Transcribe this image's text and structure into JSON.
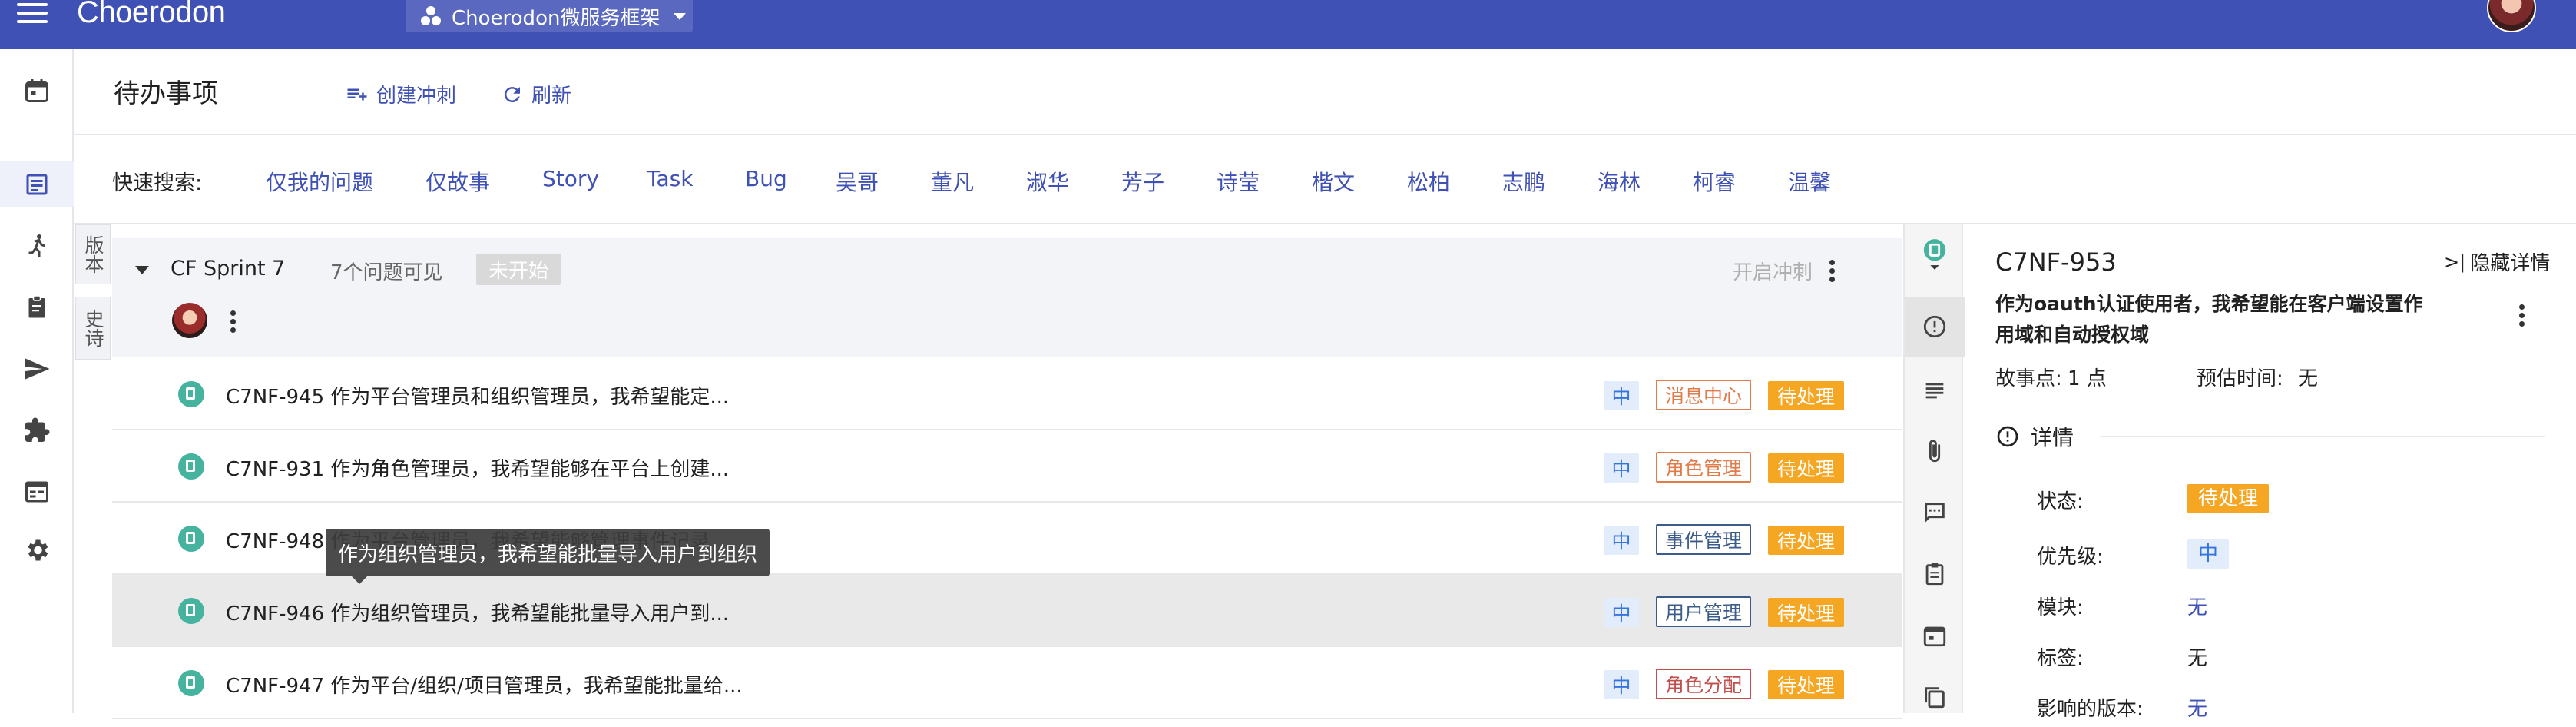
{
  "app": {
    "brand": "Choerodon",
    "project": "Choerodon微服务框架"
  },
  "page": {
    "title": "待办事项",
    "create_sprint": "创建冲刺",
    "refresh": "刷新"
  },
  "quick_search": {
    "label": "快速搜索:",
    "items": [
      "仅我的问题",
      "仅故事",
      "Story",
      "Task",
      "Bug",
      "吴哥",
      "董凡",
      "淑华",
      "芳子",
      "诗莹",
      "楷文",
      "松柏",
      "志鹏",
      "海林",
      "柯睿",
      "温馨"
    ]
  },
  "vertical_tabs": {
    "version": "版本",
    "epic": "史诗"
  },
  "sprint": {
    "name": "CF Sprint 7",
    "count": "7个问题可见",
    "status": "未开始",
    "start": "开启冲刺"
  },
  "issues": [
    {
      "text": "C7NF-945 作为平台管理员和组织管理员，我希望能定...",
      "priority": "中",
      "component": "消息中心",
      "component_color": "#e07b4a",
      "status": "待处理"
    },
    {
      "text": "C7NF-931 作为角色管理员，我希望能够在平台上创建...",
      "priority": "中",
      "component": "角色管理",
      "component_color": "#e07b4a",
      "status": "待处理"
    },
    {
      "text": "C7NF-948 作为平台管理员，我希望能够管理事件记录",
      "priority": "中",
      "component": "事件管理",
      "component_color": "#3b5b8a",
      "status": "待处理"
    },
    {
      "text": "C7NF-946 作为组织管理员，我希望能批量导入用户到...",
      "priority": "中",
      "component": "用户管理",
      "component_color": "#3b5b8a",
      "status": "待处理"
    },
    {
      "text": "C7NF-947 作为平台/组织/项目管理员，我希望能批量给...",
      "priority": "中",
      "component": "角色分配",
      "component_color": "#c0504d",
      "status": "待处理"
    }
  ],
  "tooltip": "作为组织管理员，我希望能批量导入用户到组织",
  "detail": {
    "key": "C7NF-953",
    "hide": "隐藏详情",
    "summary": "作为oauth认证使用者，我希望能在客户端设置作用域和自动授权域",
    "story_points_label": "故事点:",
    "story_points": "1 点",
    "estimate_label": "预估时间:",
    "estimate": "无",
    "section": "详情",
    "fields": {
      "status_label": "状态:",
      "status": "待处理",
      "priority_label": "优先级:",
      "priority": "中",
      "module_label": "模块:",
      "module": "无",
      "tag_label": "标签:",
      "tag": "无",
      "version_label": "影响的版本:",
      "version": "无"
    }
  },
  "colors": {
    "primary": "#3f51b5",
    "status": "#f5a623",
    "story": "#45b39d"
  }
}
